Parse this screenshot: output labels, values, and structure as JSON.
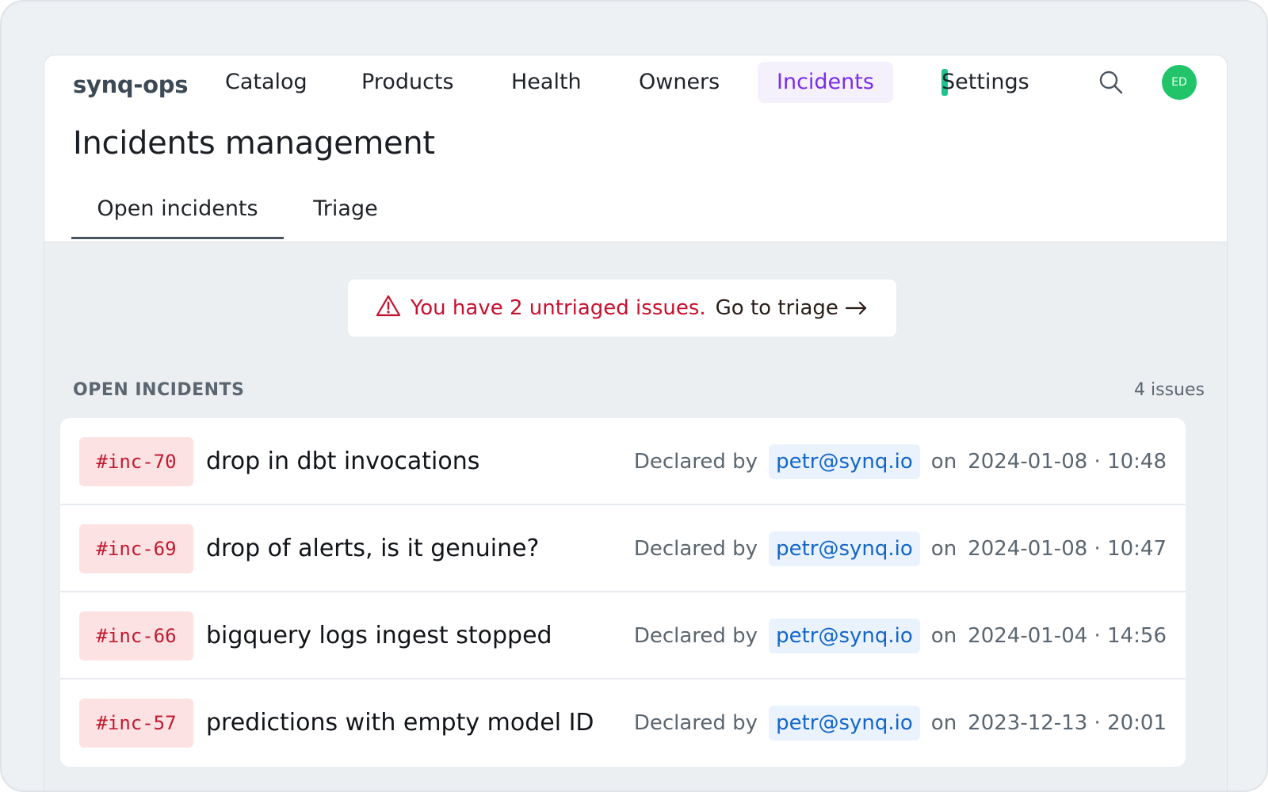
{
  "nav": {
    "brand": "synq-ops",
    "items": [
      {
        "label": "Catalog"
      },
      {
        "label": "Products"
      },
      {
        "label": "Health"
      },
      {
        "label": "Owners"
      },
      {
        "label": "Incidents",
        "active": true
      },
      {
        "label": "Settings"
      }
    ],
    "search_icon": "search-icon",
    "avatar_initials": "ED",
    "avatar_color": "#22c46a",
    "accent_color": "#7a2ee8"
  },
  "page": {
    "title": "Incidents management",
    "tabs": [
      {
        "label": "Open incidents",
        "active": true
      },
      {
        "label": "Triage"
      }
    ]
  },
  "banner": {
    "icon": "warning-icon",
    "message": "You have 2 untriaged issues.",
    "link_label": "Go to triage",
    "link_icon": "arrow-right-icon",
    "warning_color": "#c8102e"
  },
  "section": {
    "heading": "OPEN INCIDENTS",
    "count": "4 issues"
  },
  "incidents": [
    {
      "id": "#inc-70",
      "title": "drop in dbt invocations",
      "declared_by_label": "Declared by",
      "email": "petr@synq.io",
      "on_label": "on",
      "timestamp": "2024-01-08 · 10:48"
    },
    {
      "id": "#inc-69",
      "title": "drop of alerts, is it genuine?",
      "declared_by_label": "Declared by",
      "email": "petr@synq.io",
      "on_label": "on",
      "timestamp": "2024-01-08 · 10:47"
    },
    {
      "id": "#inc-66",
      "title": "bigquery logs ingest stopped",
      "declared_by_label": "Declared by",
      "email": "petr@synq.io",
      "on_label": "on",
      "timestamp": "2024-01-04 · 14:56"
    },
    {
      "id": "#inc-57",
      "title": "predictions with empty model ID",
      "declared_by_label": "Declared by",
      "email": "petr@synq.io",
      "on_label": "on",
      "timestamp": "2023-12-13 · 20:01"
    }
  ]
}
